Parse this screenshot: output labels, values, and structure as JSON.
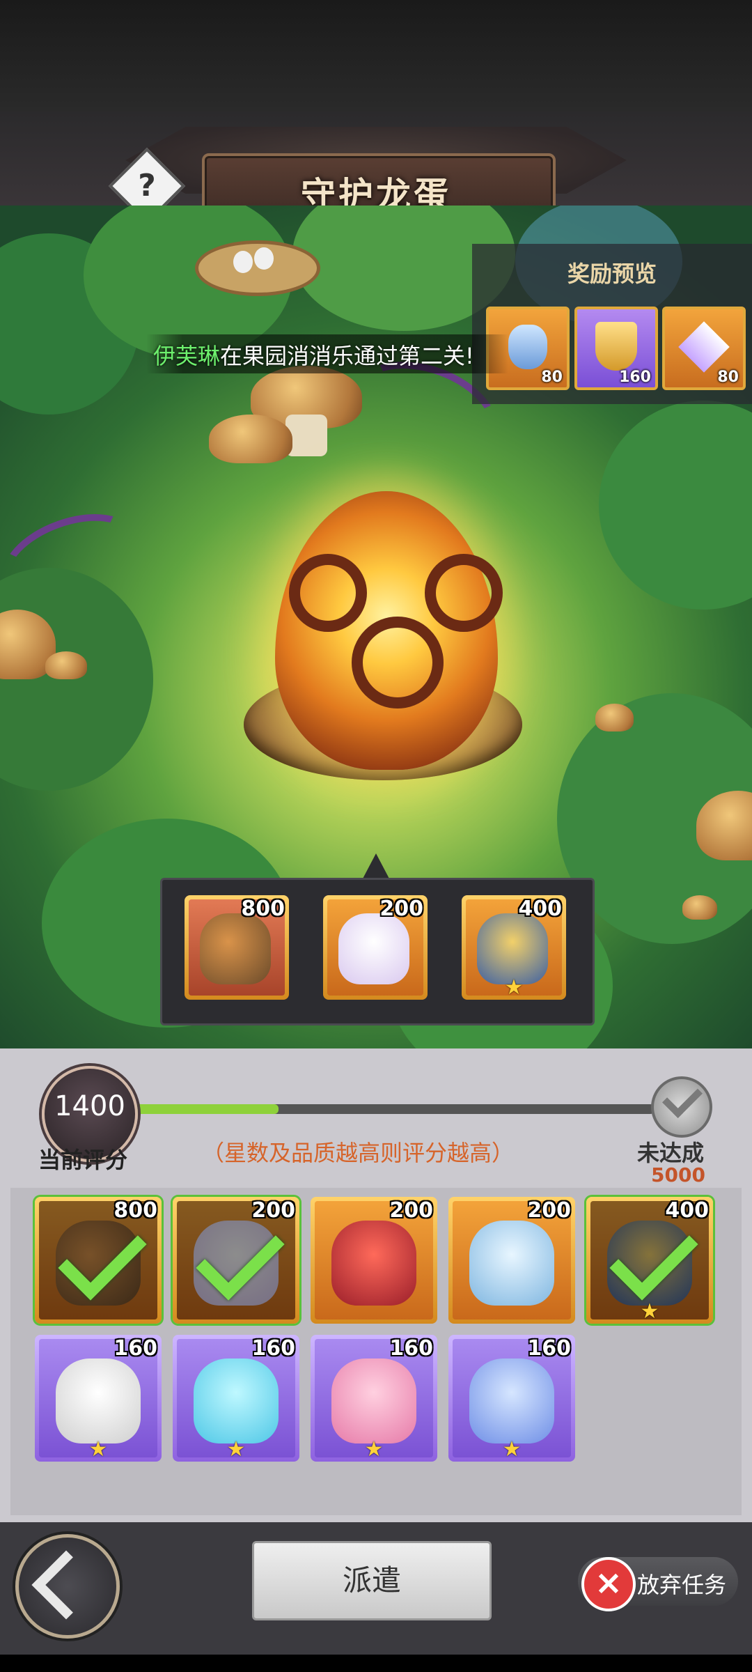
{
  "header": {
    "title": "守护龙蛋",
    "help_icon": "?"
  },
  "broadcast": {
    "name": "伊芙琳",
    "message": "在果园消消乐通过第二关!"
  },
  "reward_preview": {
    "title": "奖励预览",
    "items": [
      {
        "icon": "crystal-icon",
        "count": "80"
      },
      {
        "icon": "shield-badge-icon",
        "count": "160"
      },
      {
        "icon": "diamond-icon",
        "count": "80"
      }
    ]
  },
  "dispatched": [
    {
      "icon": "dragon-monster-icon",
      "value": "800"
    },
    {
      "icon": "white-cat-monster-icon",
      "value": "200"
    },
    {
      "icon": "gold-dragon-monster-icon",
      "value": "400"
    }
  ],
  "score": {
    "value": "1400",
    "label": "当前评分",
    "hint": "（星数及品质越高则评分越高）",
    "status": "未达成",
    "target": "5000",
    "progress": 0.28
  },
  "roster": [
    {
      "icon": "dragon-monster-icon",
      "value": "800",
      "rarity": "gold",
      "used": true
    },
    {
      "icon": "white-cat-monster-icon",
      "value": "200",
      "rarity": "gold",
      "used": true
    },
    {
      "icon": "red-dragon-monster-icon",
      "value": "200",
      "rarity": "gold",
      "used": false
    },
    {
      "icon": "unicorn-monster-icon",
      "value": "200",
      "rarity": "gold",
      "used": false
    },
    {
      "icon": "gold-dragon-monster-icon",
      "value": "400",
      "rarity": "gold",
      "used": true
    },
    {
      "icon": "sheep-monster-icon",
      "value": "160",
      "rarity": "purple",
      "used": false
    },
    {
      "icon": "spirit-deer-monster-icon",
      "value": "160",
      "rarity": "purple",
      "used": false
    },
    {
      "icon": "flower-monster-icon",
      "value": "160",
      "rarity": "purple",
      "used": false
    },
    {
      "icon": "cloud-cat-monster-icon",
      "value": "160",
      "rarity": "purple",
      "used": false
    }
  ],
  "actions": {
    "dispatch": "派遣",
    "abandon": "放弃任务"
  }
}
